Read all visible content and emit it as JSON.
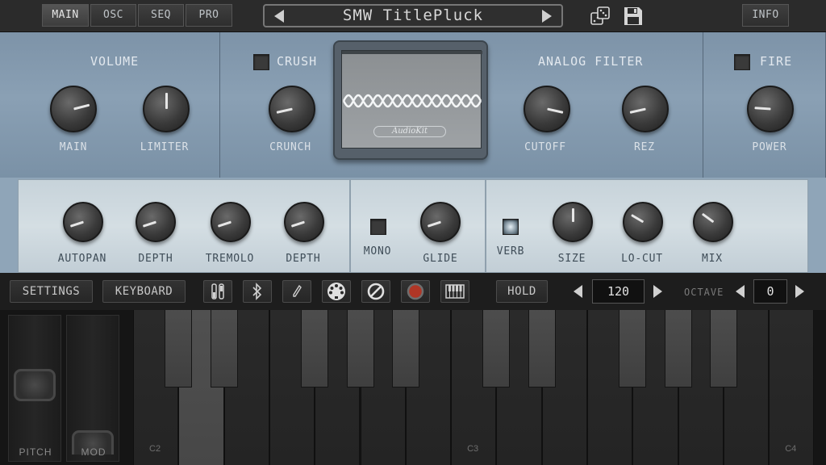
{
  "topbar": {
    "tabs": [
      "MAIN",
      "OSC",
      "SEQ",
      "PRO"
    ],
    "active_tab": "MAIN",
    "preset_name": "SMW TitlePluck",
    "info_label": "INFO"
  },
  "volume": {
    "title": "VOLUME",
    "main_label": "MAIN",
    "main_value": 0.78,
    "limiter_label": "LIMITER",
    "limiter_value": 0.5
  },
  "crush": {
    "title": "CRUSH",
    "enabled": false,
    "crunch_label": "CRUNCH",
    "crunch_value": 0.12
  },
  "scope": {
    "logo": "AudioKit"
  },
  "filter": {
    "title": "ANALOG FILTER",
    "cutoff_label": "CUTOFF",
    "cutoff_value": 0.88,
    "rez_label": "REZ",
    "rez_value": 0.12
  },
  "fire": {
    "title": "FIRE",
    "enabled": false,
    "power_label": "POWER",
    "power_value": 0.18
  },
  "modulation": {
    "autopan_label": "AUTOPAN",
    "autopan_value": 0.1,
    "depth1_label": "DEPTH",
    "depth1_value": 0.1,
    "tremolo_label": "TREMOLO",
    "tremolo_value": 0.1,
    "depth2_label": "DEPTH",
    "depth2_value": 0.1
  },
  "mono": {
    "mono_label": "MONO",
    "mono_enabled": false,
    "glide_label": "GLIDE",
    "glide_value": 0.1
  },
  "reverb": {
    "verb_label": "VERB",
    "verb_enabled": true,
    "size_label": "SIZE",
    "size_value": 0.5,
    "locut_label": "LO-CUT",
    "locut_value": 0.28,
    "mix_label": "MIX",
    "mix_value": 0.3
  },
  "toolbar": {
    "settings_label": "SETTINGS",
    "keyboard_label": "KEYBOARD",
    "hold_label": "HOLD",
    "bpm": "120",
    "octave_label": "OCTAVE",
    "octave": "0"
  },
  "keyboard": {
    "pitch_label": "PITCH",
    "mod_label": "MOD",
    "key_labels": [
      "C2",
      "C3",
      "C4"
    ],
    "pressed_note": "D2"
  },
  "colors": {
    "panel_blue": "#8aa0b4",
    "panel_light": "#d4dee3",
    "record_red": "#c0392b"
  }
}
